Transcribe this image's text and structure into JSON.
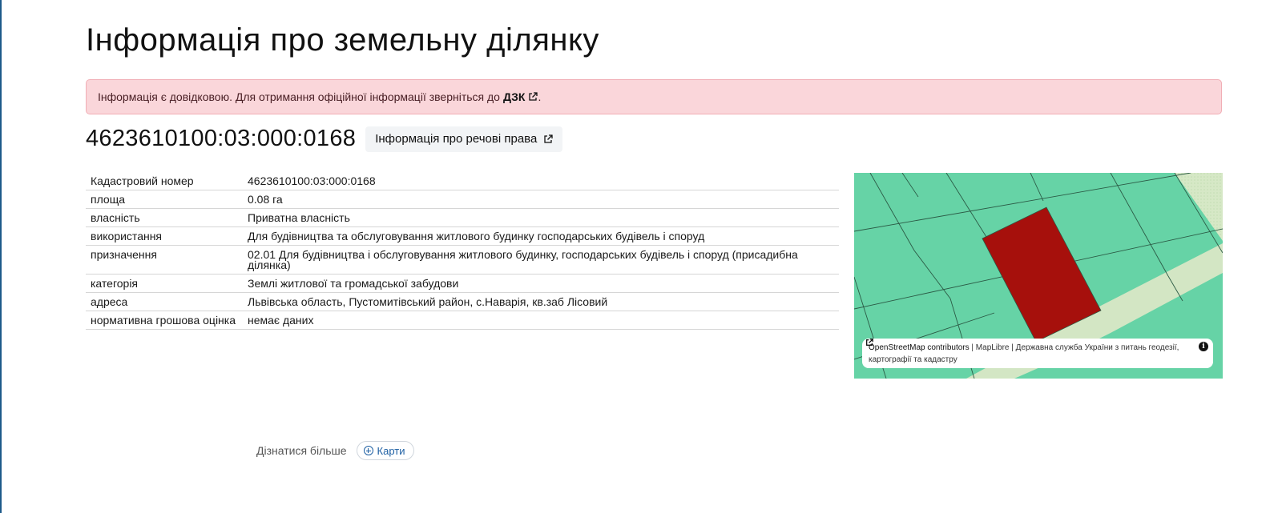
{
  "page": {
    "title": "Інформація про земельну ділянку"
  },
  "alert": {
    "text": "Інформація є довідковою. Для отримання офіційної інформації зверніться до",
    "link_label": "ДЗК",
    "suffix": "."
  },
  "parcel": {
    "cadastral_number": "4623610100:03:000:0168",
    "rights_button_label": "Інформація про речові права"
  },
  "info_table": {
    "rows": [
      {
        "label": "Кадастровий номер",
        "value": "4623610100:03:000:0168"
      },
      {
        "label": "площа",
        "value": "0.08 га"
      },
      {
        "label": "власність",
        "value": "Приватна власність"
      },
      {
        "label": "використання",
        "value": "Для будівництва та обслуговування житлового будинку господарських будівель і споруд"
      },
      {
        "label": "призначення",
        "value": "02.01 Для будівництва і обслуговування житлового будинку, господарських будівель і споруд (присадибна ділянка)"
      },
      {
        "label": "категорія",
        "value": "Землі житлової та громадської забудови"
      },
      {
        "label": "адреса",
        "value": "Львівська область, Пустомитівський район, с.Наварія, кв.заб Лісовий"
      },
      {
        "label": "нормативна грошова оцінка",
        "value": "немає даних"
      }
    ]
  },
  "map": {
    "attribution": {
      "osm": "OpenStreetMap contributors",
      "sep1": "|",
      "maplibre": "MapLibre",
      "sep2": "|",
      "agency": "Державна служба України з питань геодезії, картографії та кадастру"
    },
    "info_icon": "i",
    "colors": {
      "parcels": "#66d3a6",
      "selected_parcel": "#a6100c",
      "road": "#d3e6c4",
      "border": "#2b5a45"
    }
  },
  "footer": {
    "learn_more_label": "Дізнатися більше",
    "maps_link_label": "Карти"
  },
  "icons": {
    "external_link": "external-link-icon",
    "info": "info-icon",
    "plus_circle": "plus-circle-icon"
  }
}
